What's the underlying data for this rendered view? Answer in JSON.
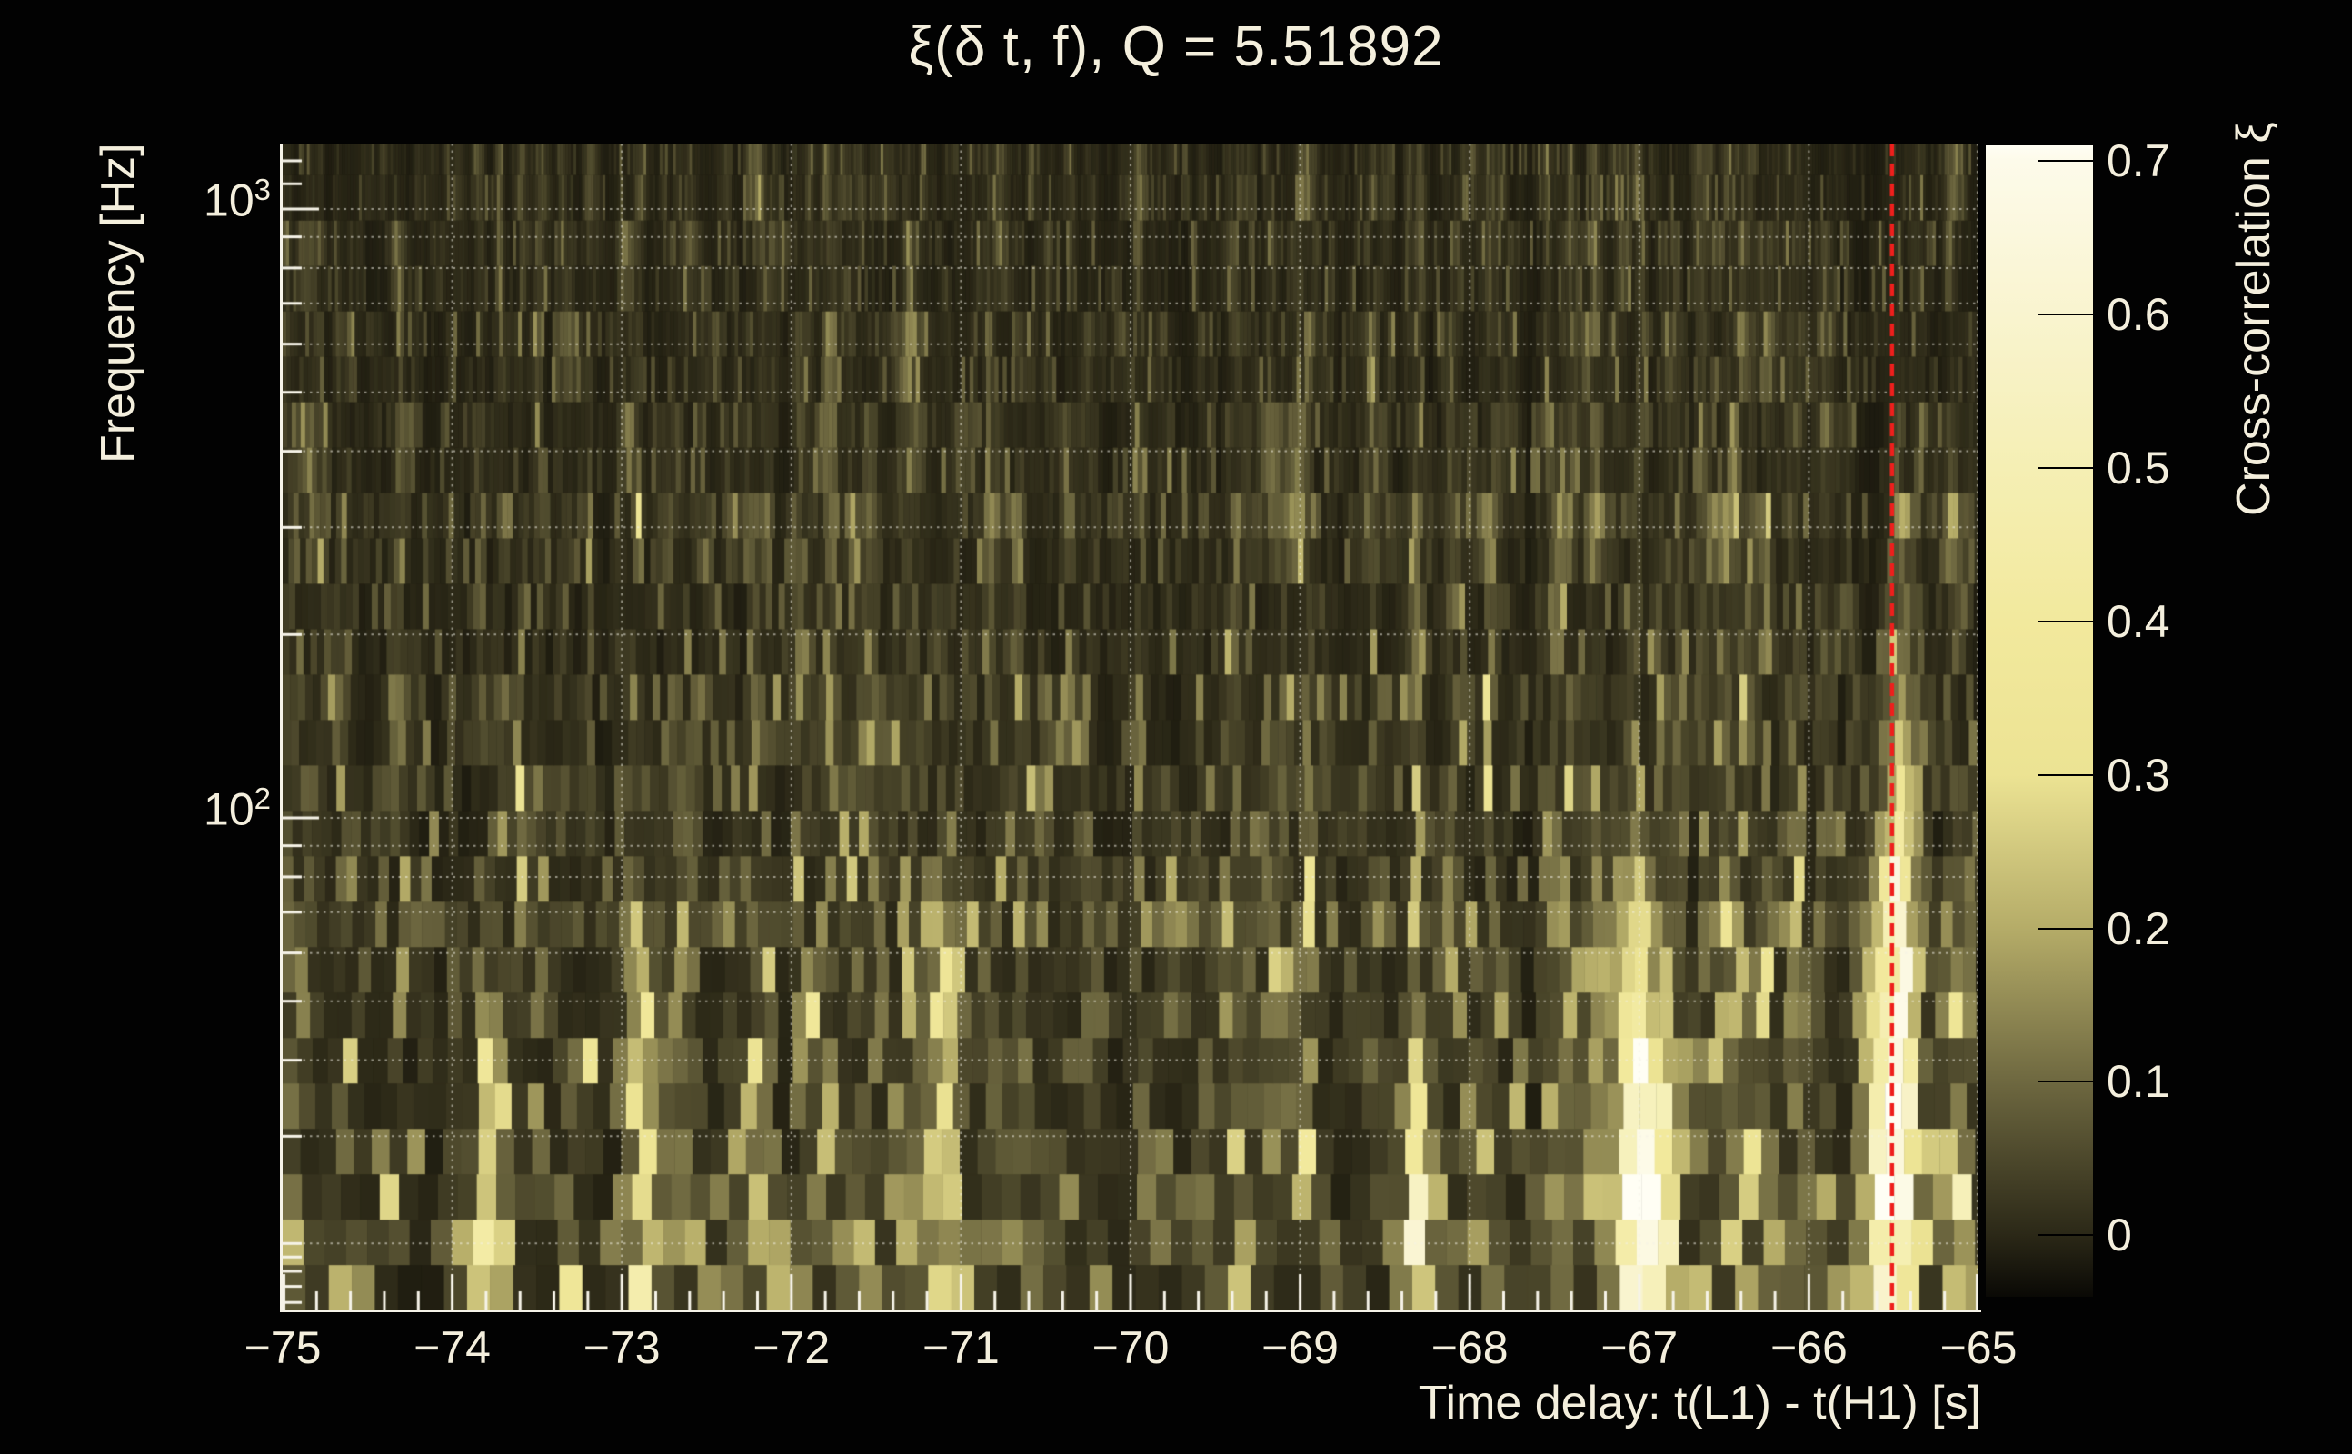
{
  "chart_data": {
    "type": "heatmap",
    "title": "ξ(δ t, f), Q = 5.51892",
    "q_value": 5.51892,
    "x": {
      "label": "Time delay: t(L1) - t(H1) [s]",
      "min": -75,
      "max": -65,
      "major_ticks": [
        -75,
        -74,
        -73,
        -72,
        -71,
        -70,
        -69,
        -68,
        -67,
        -66,
        -65
      ],
      "tick_labels": [
        "−75",
        "−74",
        "−73",
        "−72",
        "−71",
        "−70",
        "−69",
        "−68",
        "−67",
        "−66",
        "−65"
      ],
      "minor_tick_step": 0.2,
      "grid": "dotted vertical line at each major tick"
    },
    "y": {
      "label": "Frequency [Hz]",
      "scale": "log",
      "min_hz": 15.5,
      "max_hz": 1280,
      "labeled_ticks": [
        {
          "hz": 100,
          "mantissa": "10",
          "exponent": "2"
        },
        {
          "hz": 1000,
          "mantissa": "10",
          "exponent": "3"
        }
      ],
      "minor_ticks_hz": [
        16,
        17,
        18,
        19,
        20,
        30,
        40,
        50,
        60,
        70,
        80,
        90,
        200,
        300,
        400,
        500,
        600,
        700,
        800,
        900,
        1100,
        1200
      ],
      "grid_hz": [
        20,
        30,
        40,
        50,
        60,
        70,
        80,
        90,
        100,
        200,
        300,
        400,
        500,
        600,
        700,
        800,
        900,
        1000
      ]
    },
    "z": {
      "label": "Cross-correlation ξ",
      "min": -0.04,
      "max": 0.71,
      "ticks": [
        0,
        0.1,
        0.2,
        0.3,
        0.4,
        0.5,
        0.6,
        0.7
      ],
      "tick_labels": [
        "0",
        "0.1",
        "0.2",
        "0.3",
        "0.4",
        "0.5",
        "0.6",
        "0.7"
      ]
    },
    "palette": [
      {
        "v": -0.04,
        "color": "#0a0905"
      },
      {
        "v": 0.0,
        "color": "#2b2817"
      },
      {
        "v": 0.1,
        "color": "#6e6840"
      },
      {
        "v": 0.2,
        "color": "#b5ac68"
      },
      {
        "v": 0.3,
        "color": "#ece393"
      },
      {
        "v": 0.4,
        "color": "#f2e99d"
      },
      {
        "v": 0.5,
        "color": "#f5efb4"
      },
      {
        "v": 0.6,
        "color": "#f9f4cf"
      },
      {
        "v": 0.7,
        "color": "#fdfbea"
      },
      {
        "v": 0.71,
        "color": "#fffef4"
      }
    ],
    "marker_line": {
      "time_s": -65.51,
      "color": "#ee1f1c",
      "style": "dashed"
    },
    "hotspots": [
      {
        "time_s": -73.78,
        "amplitude": 0.5,
        "sigma_s": 0.06,
        "f_knee_hz": 24,
        "f_falloff": 0.6
      },
      {
        "time_s": -72.85,
        "amplitude": 0.45,
        "sigma_s": 0.055,
        "f_knee_hz": 36,
        "f_falloff": 0.5
      },
      {
        "time_s": -71.1,
        "amplitude": 0.33,
        "sigma_s": 0.055,
        "f_knee_hz": 45,
        "f_falloff": 0.45
      },
      {
        "time_s": -68.31,
        "amplitude": 0.5,
        "sigma_s": 0.07,
        "f_knee_hz": 22,
        "f_falloff": 0.55
      },
      {
        "time_s": -67.0,
        "amplitude": 1.0,
        "sigma_s": 0.09,
        "f_knee_hz": 26,
        "f_falloff": 0.8
      },
      {
        "time_s": -66.82,
        "amplitude": 0.45,
        "sigma_s": 0.05,
        "f_knee_hz": 22,
        "f_falloff": 0.6
      },
      {
        "time_s": -65.62,
        "amplitude": 0.85,
        "sigma_s": 0.05,
        "f_knee_hz": 30,
        "f_falloff": 0.7
      },
      {
        "time_s": -65.47,
        "amplitude": 1.1,
        "sigma_s": 0.064,
        "f_knee_hz": 36,
        "f_falloff": 1.1
      },
      {
        "time_s": -65.12,
        "amplitude": 0.38,
        "sigma_s": 0.05,
        "f_knee_hz": 20,
        "f_falloff": 0.5
      }
    ],
    "texture": {
      "seed": 1234,
      "rows_per_decade": 13.4,
      "background_xi": 0.0
    }
  }
}
